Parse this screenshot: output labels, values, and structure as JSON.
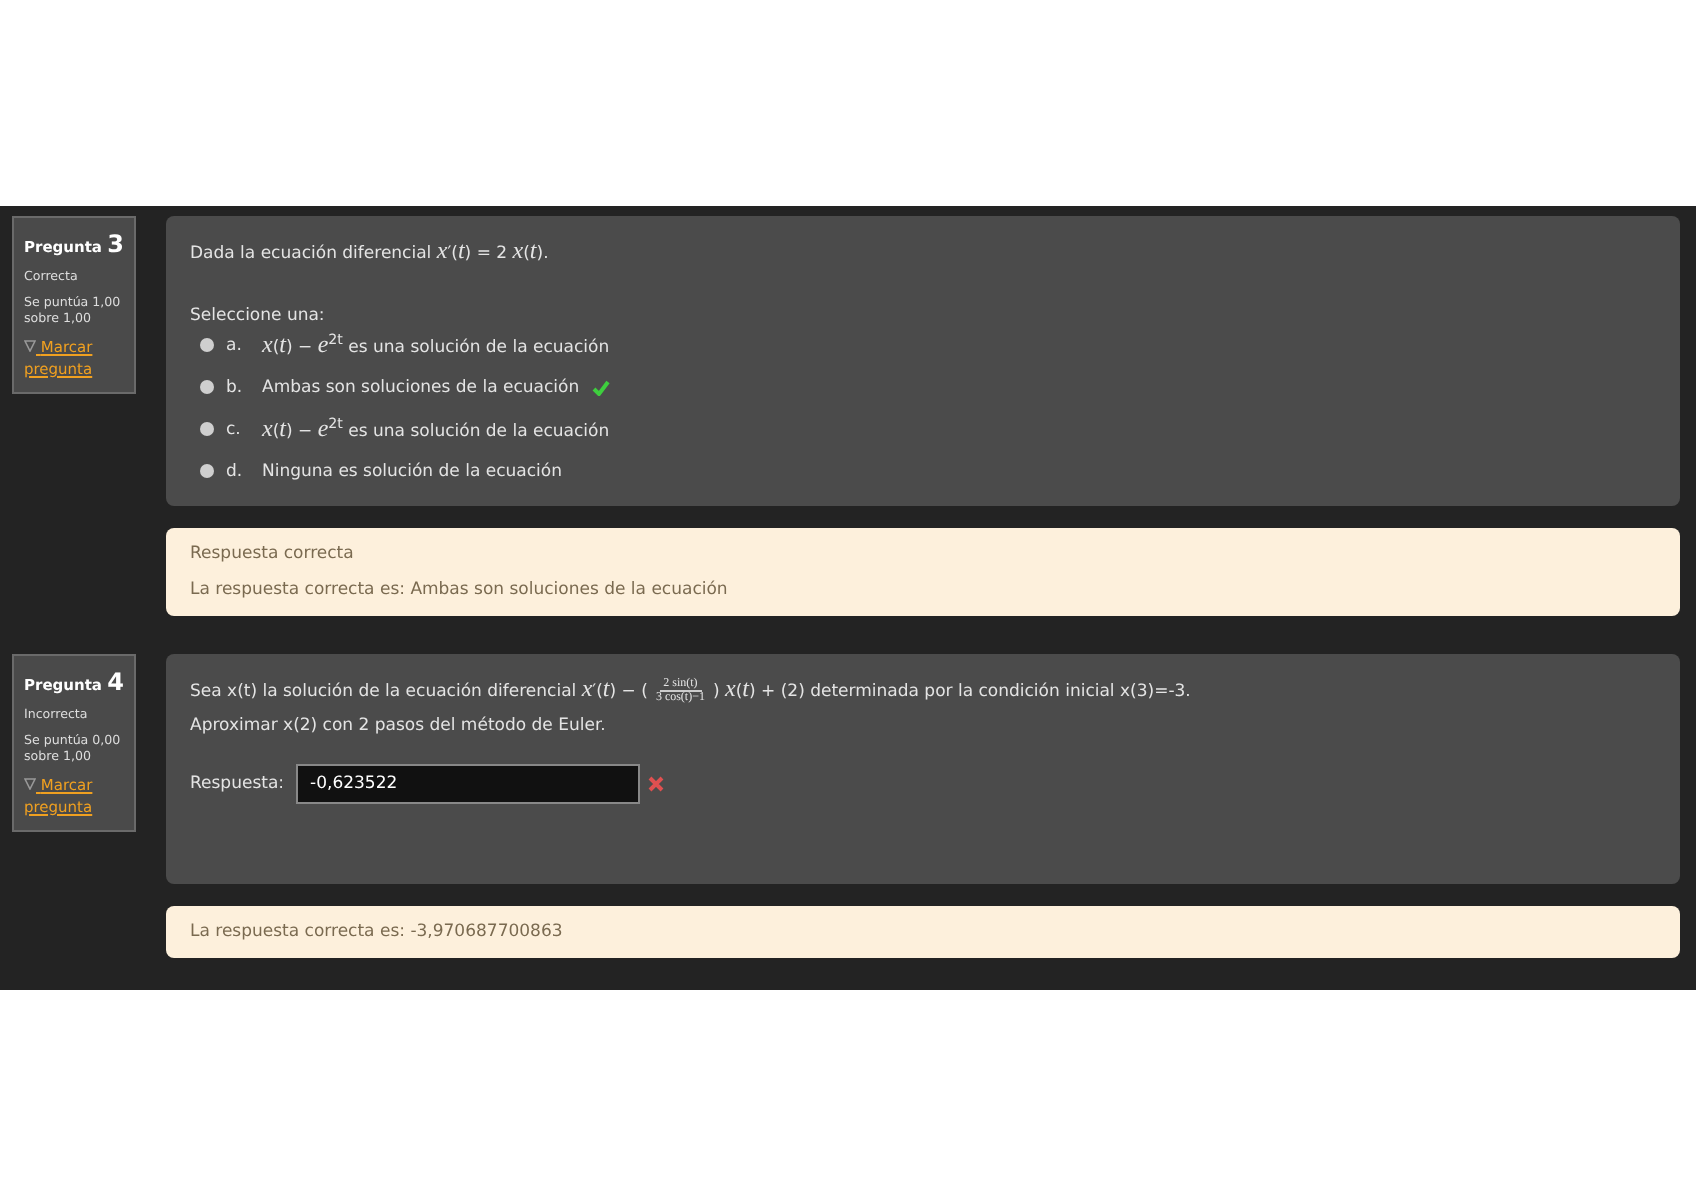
{
  "questions": [
    {
      "number_label": "Pregunta",
      "number": "3",
      "status": "Correcta",
      "score": "Se puntúa 1,00 sobre 1,00",
      "flag": "Marcar pregunta",
      "kind": "choice",
      "prompt": "Dada la ecuación diferencial *x*′(*t*) = 2 *x*(*t*).",
      "instruction": "Seleccione una:",
      "options": [
        {
          "letter": "a.",
          "text": "*x*(*t*) −   *e*$^{2t}$ es una solución de la ecuación",
          "selected": false,
          "correct": false
        },
        {
          "letter": "b.",
          "text": "Ambas son soluciones de la ecuación",
          "selected": false,
          "correct": true
        },
        {
          "letter": "c.",
          "text": "*x*(*t*) − *e*$^{2t}$ es una solución de la ecuación",
          "selected": false,
          "correct": false
        },
        {
          "letter": "d.",
          "text": "Ninguna es solución de la ecuación",
          "selected": false,
          "correct": false
        }
      ],
      "feedback": [
        "Respuesta correcta",
        "La respuesta correcta es: Ambas son soluciones de la ecuación"
      ]
    },
    {
      "number_label": "Pregunta",
      "number": "4",
      "status": "Incorrecta",
      "score": "Se puntúa 0,00 sobre 1,00",
      "flag": "Marcar pregunta",
      "kind": "numeric",
      "prompt_parts": {
        "before": "Sea x(t) la solución de la ecuación diferencial *x*′(*t*) − (",
        "numerator": "2 sin(t)",
        "denominator": "3 cos(t)−1",
        "after": ") *x*(*t*) + (2) determinada por la condición inicial x(3)=-3."
      },
      "instruction": "Aproximar x(2) con 2 pasos del método de Euler.",
      "answer": {
        "label": "Respuesta:",
        "value": "-0,623522",
        "correct": false
      },
      "feedback": [
        "La respuesta correcta es: -3,970687700863"
      ]
    }
  ]
}
